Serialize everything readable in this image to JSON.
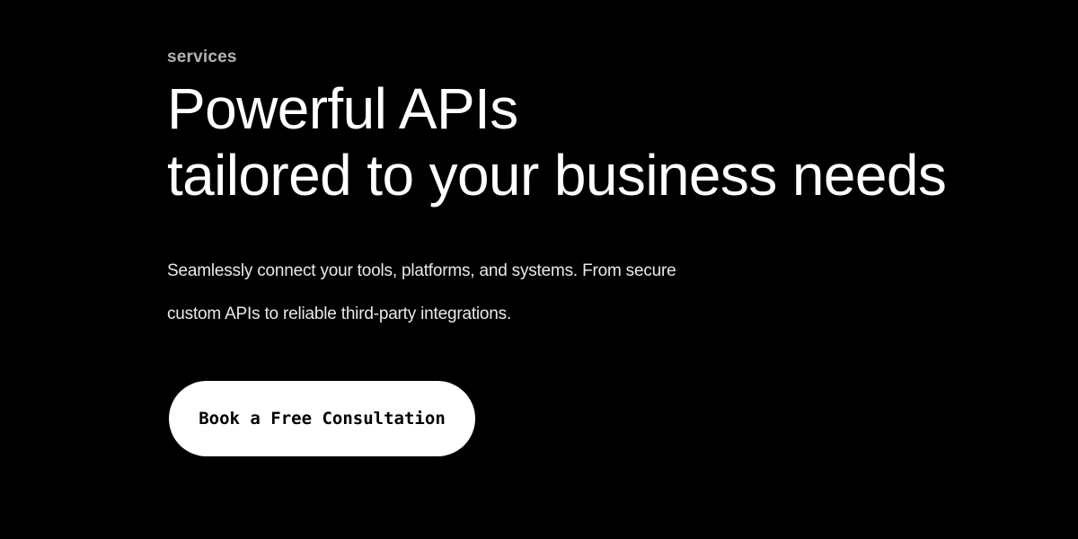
{
  "hero": {
    "eyebrow": "services",
    "headline_line1": "Powerful APIs",
    "headline_line2": "tailored to your business needs",
    "description_line1": "Seamlessly connect your tools, platforms, and systems. From secure",
    "description_line2": "custom APIs to reliable third-party integrations.",
    "cta_label": "Book a Free Consultation"
  },
  "colors": {
    "background": "#000000",
    "text": "#ffffff",
    "muted_text": "#b3b3b3",
    "button_background": "#ffffff",
    "button_text": "#000000"
  }
}
